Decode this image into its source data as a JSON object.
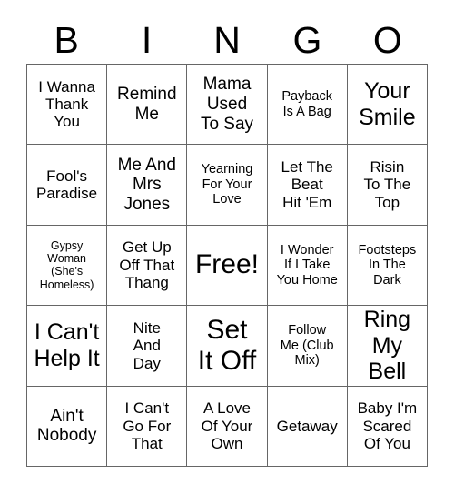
{
  "card": {
    "header": {
      "letters": [
        "B",
        "I",
        "N",
        "G",
        "O"
      ]
    },
    "grid": {
      "rows": 5,
      "columns": 5,
      "border_color": "#666666",
      "background_color": "#ffffff",
      "text_color": "#000000",
      "cells": [
        {
          "text": "I Wanna\nThank\nYou",
          "size": "m",
          "free": false
        },
        {
          "text": "Remind\nMe",
          "size": "l",
          "free": false
        },
        {
          "text": "Mama\nUsed\nTo Say",
          "size": "l",
          "free": false
        },
        {
          "text": "Payback\nIs A Bag",
          "size": "s",
          "free": false
        },
        {
          "text": "Your\nSmile",
          "size": "xl",
          "free": false
        },
        {
          "text": "Fool's\nParadise",
          "size": "m",
          "free": false
        },
        {
          "text": "Me And\nMrs\nJones",
          "size": "l",
          "free": false
        },
        {
          "text": "Yearning\nFor Your\nLove",
          "size": "s",
          "free": false
        },
        {
          "text": "Let The\nBeat\nHit 'Em",
          "size": "m",
          "free": false
        },
        {
          "text": "Risin\nTo The\nTop",
          "size": "m",
          "free": false
        },
        {
          "text": "Gypsy\nWoman\n(She's\nHomeless)",
          "size": "xs",
          "free": false
        },
        {
          "text": "Get Up\nOff That\nThang",
          "size": "m",
          "free": false
        },
        {
          "text": "Free!",
          "size": "xxl",
          "free": true
        },
        {
          "text": "I Wonder\nIf I Take\nYou Home",
          "size": "s",
          "free": false
        },
        {
          "text": "Footsteps\nIn The\nDark",
          "size": "s",
          "free": false
        },
        {
          "text": "I Can't\nHelp It",
          "size": "xl",
          "free": false
        },
        {
          "text": "Nite\nAnd\nDay",
          "size": "m",
          "free": false
        },
        {
          "text": "Set\nIt Off",
          "size": "xxl",
          "free": false
        },
        {
          "text": "Follow\nMe (Club\nMix)",
          "size": "s",
          "free": false
        },
        {
          "text": "Ring\nMy Bell",
          "size": "xl",
          "free": false
        },
        {
          "text": "Ain't\nNobody",
          "size": "l",
          "free": false
        },
        {
          "text": "I Can't\nGo For\nThat",
          "size": "m",
          "free": false
        },
        {
          "text": "A Love\nOf Your\nOwn",
          "size": "m",
          "free": false
        },
        {
          "text": "Getaway",
          "size": "m",
          "free": false
        },
        {
          "text": "Baby I'm\nScared\nOf You",
          "size": "m",
          "free": false
        }
      ]
    }
  }
}
